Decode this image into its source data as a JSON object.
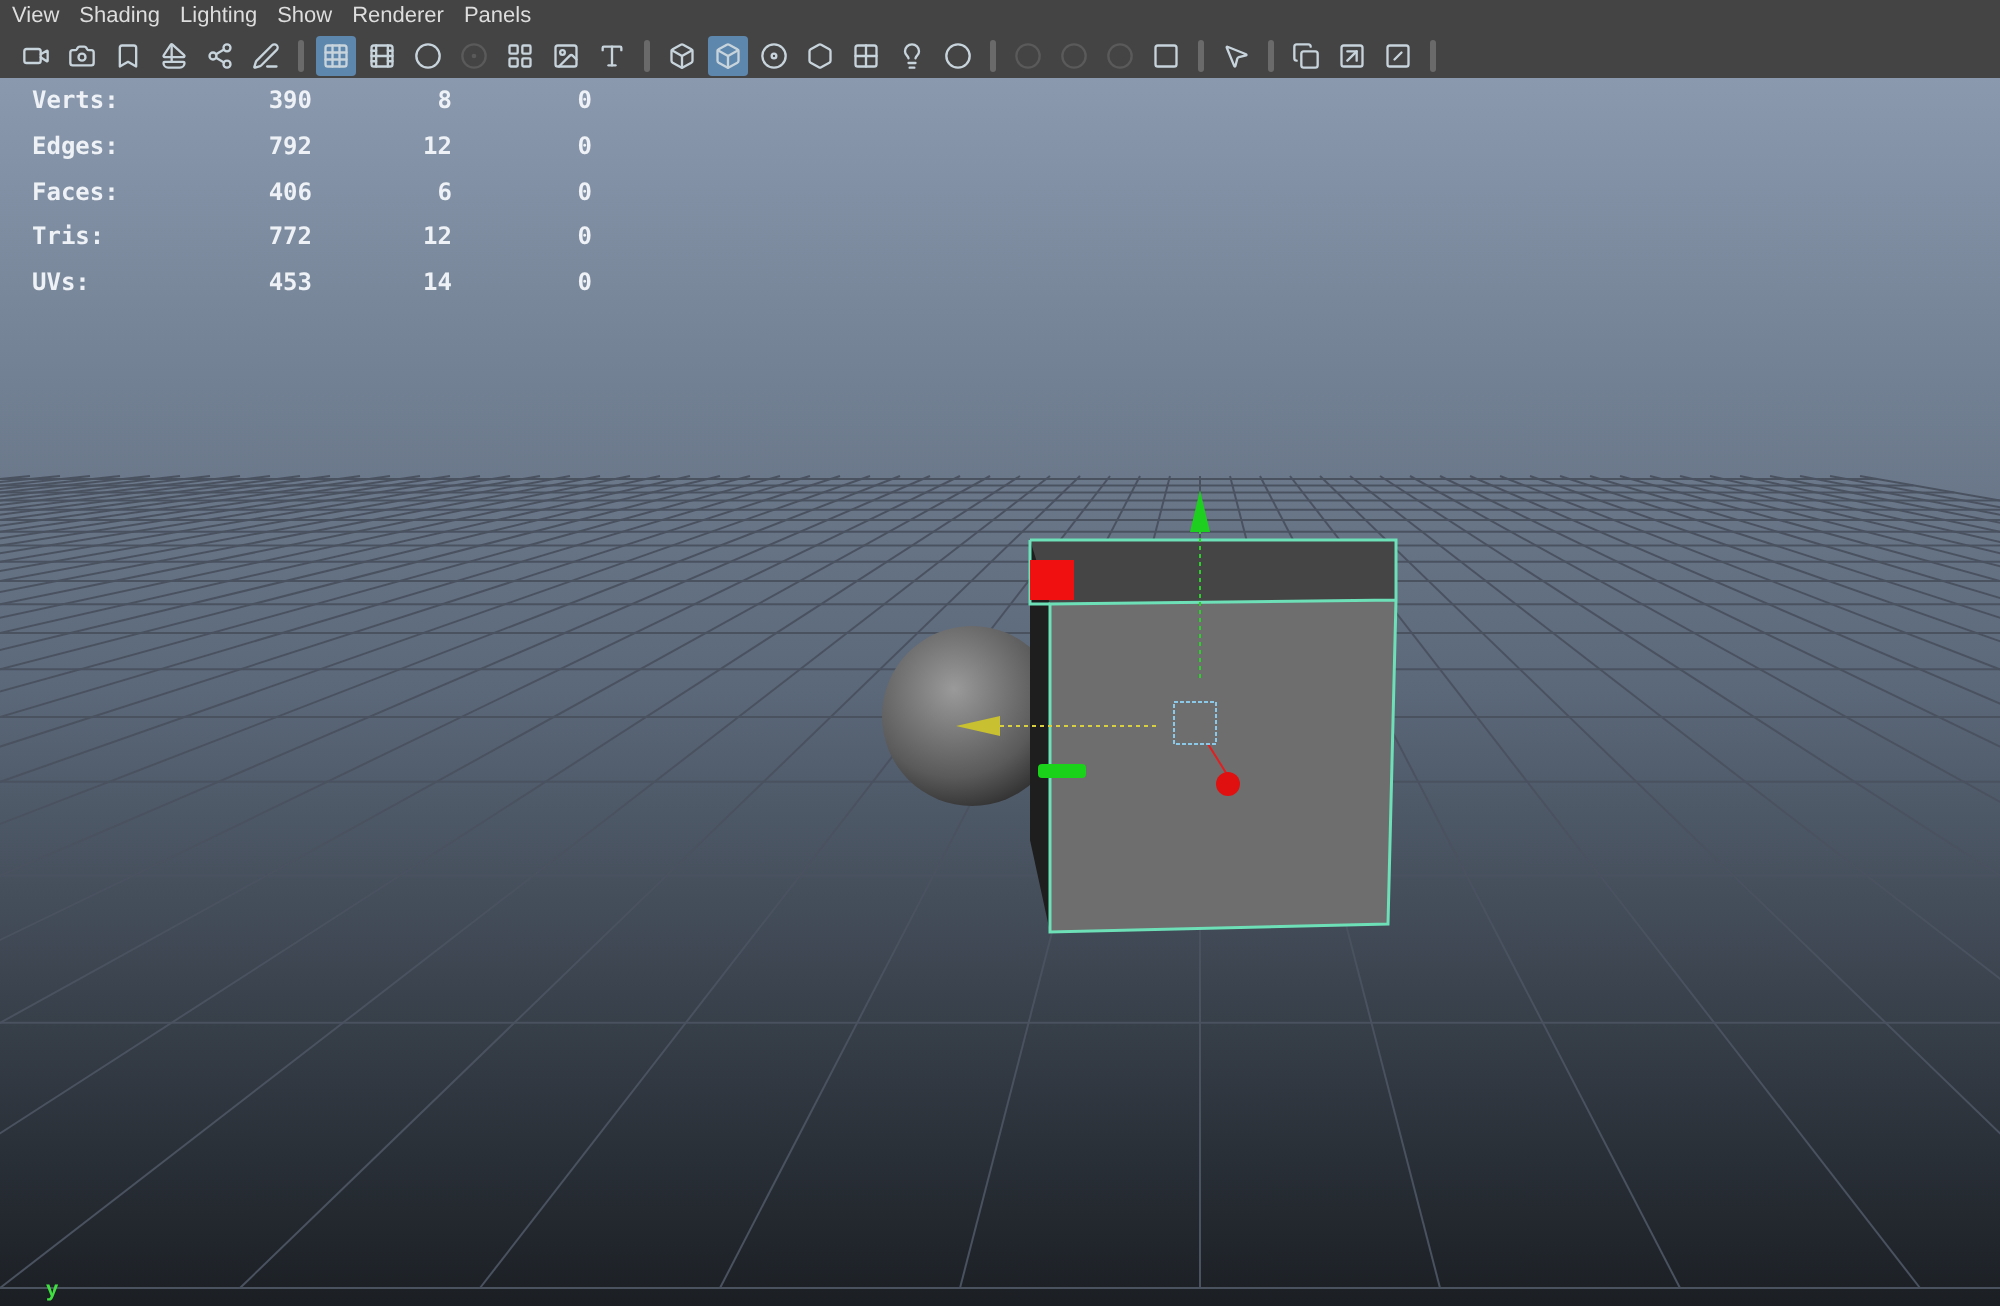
{
  "menu_bar": [
    "View",
    "Shading",
    "Lighting",
    "Show",
    "Renderer",
    "Panels"
  ],
  "toolbar": [
    {
      "kind": "button",
      "selected": false,
      "disabled": false
    },
    {
      "kind": "button",
      "selected": false,
      "disabled": false
    },
    {
      "kind": "button",
      "selected": false,
      "disabled": false
    },
    {
      "kind": "button",
      "selected": false,
      "disabled": false
    },
    {
      "kind": "button",
      "selected": false,
      "disabled": false
    },
    {
      "kind": "button",
      "selected": false,
      "disabled": false
    },
    {
      "kind": "separator"
    },
    {
      "kind": "button",
      "selected": true,
      "disabled": false
    },
    {
      "kind": "button",
      "selected": false,
      "disabled": false
    },
    {
      "kind": "button",
      "selected": false,
      "disabled": false
    },
    {
      "kind": "button",
      "selected": false,
      "disabled": true
    },
    {
      "kind": "button",
      "selected": false,
      "disabled": false
    },
    {
      "kind": "button",
      "selected": false,
      "disabled": false
    },
    {
      "kind": "button",
      "selected": false,
      "disabled": false
    },
    {
      "kind": "separator"
    },
    {
      "kind": "button",
      "selected": false,
      "disabled": false
    },
    {
      "kind": "button",
      "selected": true,
      "disabled": false
    },
    {
      "kind": "button",
      "selected": false,
      "disabled": false
    },
    {
      "kind": "button",
      "selected": false,
      "disabled": false
    },
    {
      "kind": "button",
      "selected": false,
      "disabled": false
    },
    {
      "kind": "button",
      "selected": false,
      "disabled": false
    },
    {
      "kind": "button",
      "selected": false,
      "disabled": false
    },
    {
      "kind": "separator"
    },
    {
      "kind": "button",
      "selected": false,
      "disabled": true
    },
    {
      "kind": "button",
      "selected": false,
      "disabled": true
    },
    {
      "kind": "button",
      "selected": false,
      "disabled": true
    },
    {
      "kind": "button",
      "selected": false,
      "disabled": false
    },
    {
      "kind": "separator"
    },
    {
      "kind": "button",
      "selected": false,
      "disabled": false
    },
    {
      "kind": "separator"
    },
    {
      "kind": "button",
      "selected": false,
      "disabled": false
    },
    {
      "kind": "button",
      "selected": false,
      "disabled": false
    },
    {
      "kind": "button",
      "selected": false,
      "disabled": false
    },
    {
      "kind": "separator"
    }
  ],
  "stats": [
    {
      "label": "Verts:",
      "values": [
        "390",
        "8",
        "0"
      ]
    },
    {
      "label": "Edges:",
      "values": [
        "792",
        "12",
        "0"
      ]
    },
    {
      "label": "Faces:",
      "values": [
        "406",
        "6",
        "0"
      ]
    },
    {
      "label": "Tris:",
      "values": [
        "772",
        "12",
        "0"
      ]
    },
    {
      "label": "UVs:",
      "values": [
        "453",
        "14",
        "0"
      ]
    }
  ],
  "axis_label": "y"
}
